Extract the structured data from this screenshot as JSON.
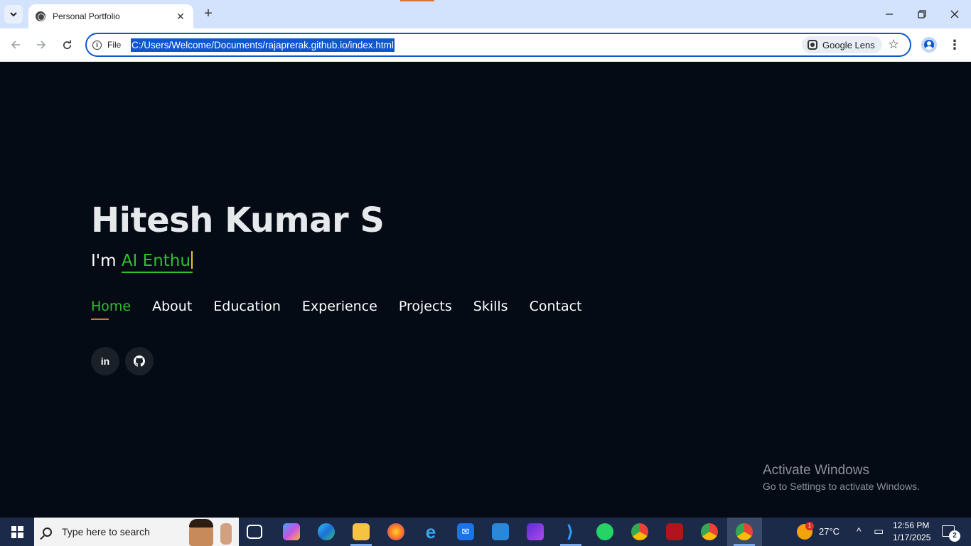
{
  "browser": {
    "tab_title": "Personal Portfolio",
    "url_scheme_label": "File",
    "url": "C:/Users/Welcome/Documents/rajaprerak.github.io/index.html",
    "lens_label": "Google Lens"
  },
  "hero": {
    "name": "Hitesh Kumar S",
    "intro_prefix": "I'm ",
    "typed_text": "AI Enthu"
  },
  "nav": {
    "items": [
      {
        "label": "Home",
        "active": true
      },
      {
        "label": "About",
        "active": false
      },
      {
        "label": "Education",
        "active": false
      },
      {
        "label": "Experience",
        "active": false
      },
      {
        "label": "Projects",
        "active": false
      },
      {
        "label": "Skills",
        "active": false
      },
      {
        "label": "Contact",
        "active": false
      }
    ]
  },
  "social": {
    "linkedin_glyph": "in",
    "github_icon": "github-icon"
  },
  "watermark": {
    "title": "Activate Windows",
    "subtitle": "Go to Settings to activate Windows."
  },
  "taskbar": {
    "search_placeholder": "Type here to search",
    "weather": "27°C",
    "weather_alert": "1",
    "time": "12:56 PM",
    "date": "1/17/2025",
    "notification_count": "2"
  },
  "colors": {
    "page_bg": "#040b14",
    "accent_green": "#2fbf2f",
    "active_underline": "#c97a2e",
    "url_highlight": "#0b57d0"
  }
}
